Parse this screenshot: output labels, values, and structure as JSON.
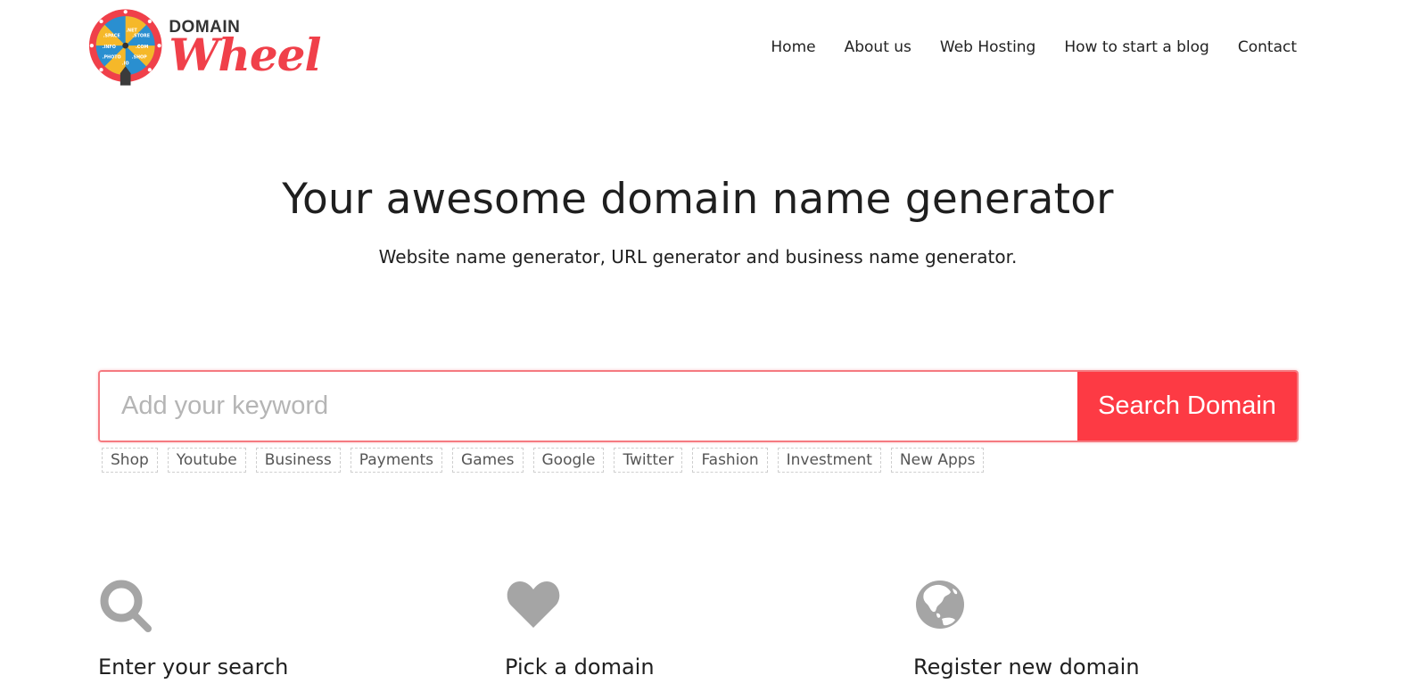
{
  "header": {
    "logo": {
      "top_text": "DOMAIN",
      "bottom_text": "Wheel",
      "wheel_labels": [
        ".NET",
        ".STORE",
        ".COM",
        ".SHOP",
        ".IO",
        ".PHOTO",
        ".INFO",
        ".SPACE"
      ]
    },
    "nav": [
      {
        "label": "Home"
      },
      {
        "label": "About us"
      },
      {
        "label": "Web Hosting"
      },
      {
        "label": "How to start a blog"
      },
      {
        "label": "Contact"
      }
    ]
  },
  "hero": {
    "title": "Your awesome domain name generator",
    "subtitle": "Website name generator, URL generator and business name generator."
  },
  "search": {
    "placeholder": "Add your keyword",
    "value": "",
    "button_label": "Search Domain"
  },
  "tags": [
    "Shop",
    "Youtube",
    "Business",
    "Payments",
    "Games",
    "Google",
    "Twitter",
    "Fashion",
    "Investment",
    "New Apps"
  ],
  "features": [
    {
      "icon": "search-icon",
      "label": "Enter your search"
    },
    {
      "icon": "heart-icon",
      "label": "Pick a domain"
    },
    {
      "icon": "globe-icon",
      "label": "Register new domain"
    }
  ],
  "colors": {
    "accent": "#fd3a44",
    "logo_red": "#f0404a",
    "logo_yellow": "#f5b829",
    "logo_blue": "#2a8fd0",
    "icon_gray": "#a5a5a5",
    "text": "#1f1f1f"
  }
}
